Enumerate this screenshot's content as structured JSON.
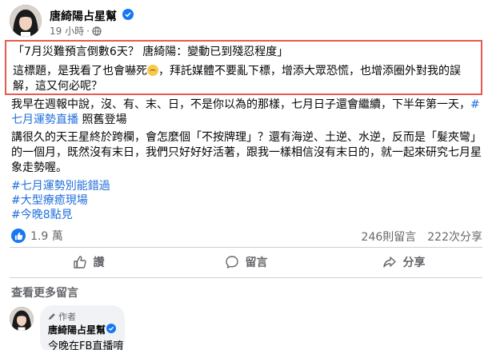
{
  "post": {
    "page_name": "唐綺陽占星幫",
    "time": "19 小時",
    "separator": "·",
    "highlight_title": "「7月災難預言倒數6天？ 唐綺陽：變動已到殘忍程度」",
    "highlight_body_1": "這標題，是我看了也會嚇死",
    "highlight_body_2": "，拜託媒體不要亂下標，增添大眾恐慌，也增添圈外對我的誤解，這又何必呢？",
    "para1_text": "我早在週報中說，沒、有、末、日，不是你以為的那樣，七月日子還會繼續，下半年第一天，",
    "para1_hashtag": "#七月運勢直播",
    "para1_tail": " 照舊登場",
    "para2": "講很久的天王星終於跨欄，會怎麼個「不按牌理」？還有海逆、土逆、水逆，反而是「髮夾彎」的一個月，既然沒有末日，我們只好好好活著，跟我一樣相信沒有末日的，就一起來研究七月星象走勢喔。",
    "hashtags": [
      "#七月運勢別能錯過",
      "#大型療癒現場",
      "#今晚8點見"
    ]
  },
  "reactions": {
    "count": "1.9 萬",
    "comments": "246則留言",
    "shares": "222次分享"
  },
  "actions": {
    "like": "讚",
    "comment": "留言",
    "share": "分享"
  },
  "comments": {
    "view_more": "查看更多留言",
    "first": {
      "author_label": "作者",
      "name": "唐綺陽占星幫",
      "text": "今晚在FB直播唷"
    }
  },
  "colors": {
    "accent": "#1877f2",
    "hashtag": "#216fdb",
    "highlight_border": "#e85a4f"
  },
  "icons": {
    "verified": "verified-badge-icon",
    "globe": "globe-icon",
    "more": "more-horizontal-icon",
    "close": "close-icon",
    "like": "thumbs-up-icon",
    "comment": "comment-bubble-icon",
    "share": "share-arrow-icon",
    "author": "pencil-icon"
  }
}
